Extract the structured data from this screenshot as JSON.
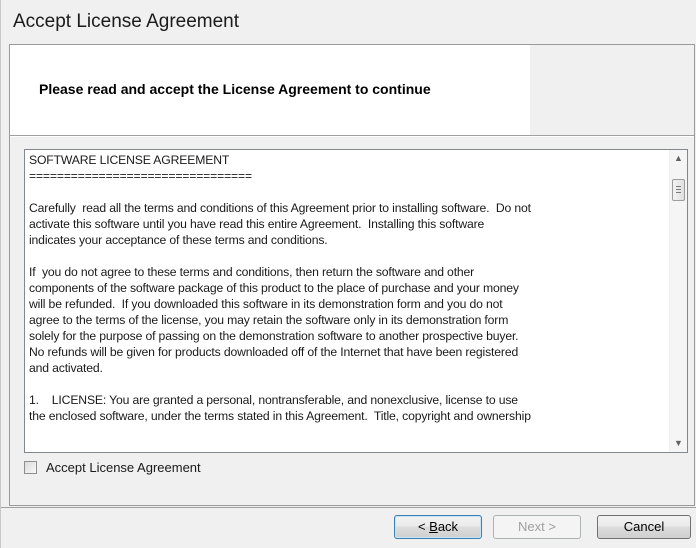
{
  "window": {
    "title": "Accept License Agreement"
  },
  "header": {
    "instruction": "Please read and accept the License Agreement to continue"
  },
  "license": {
    "text": "SOFTWARE LICENSE AGREEMENT\n================================\n\nCarefully  read all the terms and conditions of this Agreement prior to installing software.  Do not\nactivate this software until you have read this entire Agreement.  Installing this software\nindicates your acceptance of these terms and conditions.\n\nIf  you do not agree to these terms and conditions, then return the software and other\ncomponents of the software package of this product to the place of purchase and your money\nwill be refunded.  If you downloaded this software in its demonstration form and you do not\nagree to the terms of the license, you may retain the software only in its demonstration form\nsolely for the purpose of passing on the demonstration software to another prospective buyer.\nNo refunds will be given for products downloaded off of the Internet that have been registered\nand activated.\n\n1.    LICENSE: You are granted a personal, nontransferable, and nonexclusive, license to use\nthe enclosed software, under the terms stated in this Agreement.  Title, copyright and ownership"
  },
  "scrollbar": {
    "up_icon": "triangle-up",
    "down_icon": "triangle-down",
    "position": 0.05
  },
  "accept": {
    "label": "Accept License Agreement",
    "checked": false
  },
  "buttons": {
    "back_label": "< Back",
    "back_mnemonic": "B",
    "next_label": "Next >",
    "cancel_label": "Cancel"
  }
}
